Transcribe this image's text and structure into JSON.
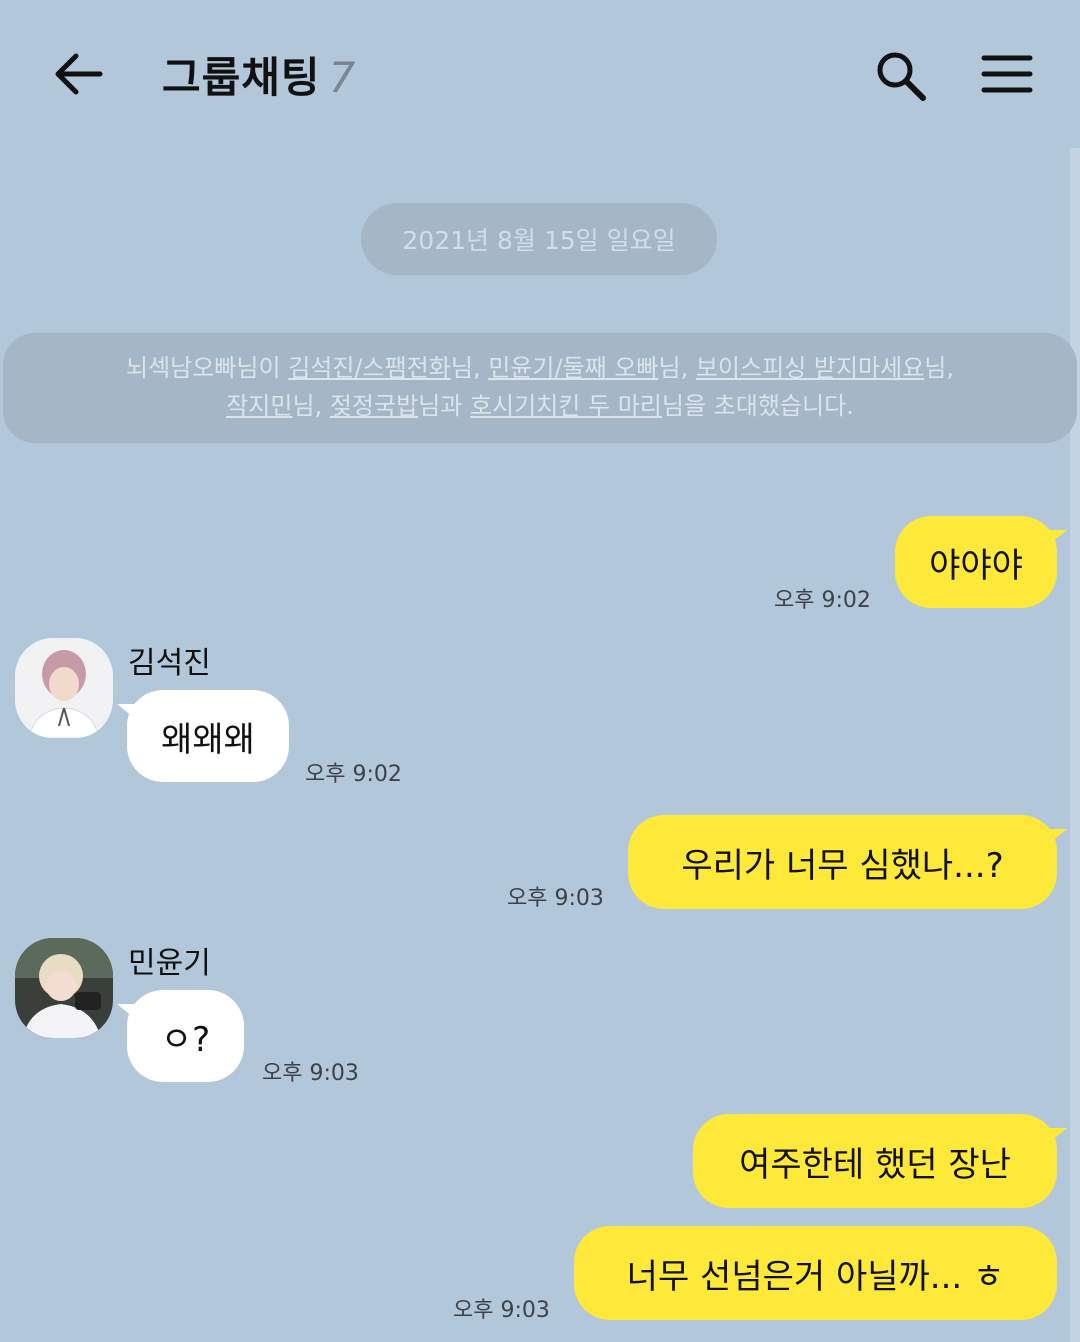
{
  "header": {
    "back_icon": "arrow-left-icon",
    "title": "그룹채팅",
    "member_count": "7",
    "search_icon": "search-icon",
    "menu_icon": "hamburger-menu-icon"
  },
  "date_divider": "2021년 8월 15일 일요일",
  "system_message": {
    "inviter": "뇌섹남오빠님이",
    "invitees": [
      "김석진/스팸전화",
      "민윤기/둘째 오빠",
      "보이스피싱 받지마세요",
      "작지민",
      "젖정국밥",
      "호시기치킨 두 마리"
    ],
    "suffix_nim": "님",
    "sep": ", ",
    "last_join": "님과",
    "tail": "님을 초대했습니다."
  },
  "messages": [
    {
      "sender": "me",
      "text": "야야야",
      "time": "오후 9:02"
    },
    {
      "sender": "김석진",
      "text": "왜왜왜",
      "time": "오후 9:02"
    },
    {
      "sender": "me",
      "text": "우리가 너무 심했나...?",
      "time": "오후 9:03"
    },
    {
      "sender": "민윤기",
      "text": "ㅇ?",
      "time": "오후 9:03"
    },
    {
      "sender": "me",
      "text": "여주한테 했던 장난",
      "time": ""
    },
    {
      "sender": "me",
      "text": "너무 선넘은거 아닐까... ㅎ",
      "time": "오후 9:03"
    }
  ],
  "colors": {
    "background": "#b2c7da",
    "my_bubble": "#fee93b",
    "their_bubble": "#ffffff",
    "notice": "#a5b7c7"
  }
}
